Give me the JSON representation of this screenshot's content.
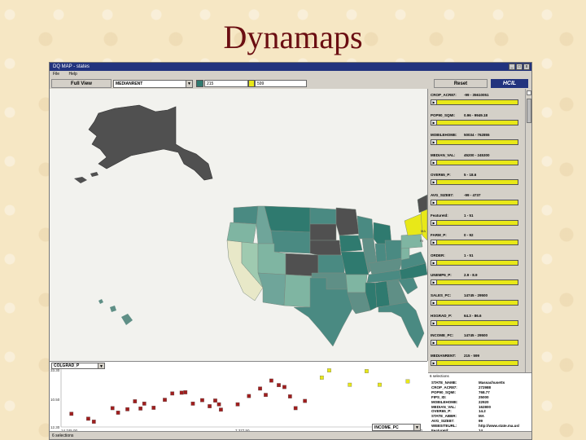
{
  "slide": {
    "title": "Dynamaps"
  },
  "window": {
    "title": "DQ MAP - states",
    "menu": [
      "File",
      "Help"
    ],
    "controls": [
      "_",
      "□",
      "x"
    ]
  },
  "toolbar": {
    "full_view_label": "Full View",
    "attribute_select": "MEDIANRENT",
    "range_low": "215",
    "range_high": "599",
    "reset_label": "Reset",
    "logo": "HCIL",
    "low_color": "#2f7a6f",
    "high_color": "#e8e818"
  },
  "sliders": [
    {
      "name": "CROP_ACR87:",
      "range": "-99 - 35610051"
    },
    {
      "name": "POP90_SQMI:",
      "range": "0.96 - 9949.18"
    },
    {
      "name": "MOBILEHOME:",
      "range": "50034 - 762855"
    },
    {
      "name": "MEDIAN_VAL:",
      "range": "45200 - 245300"
    },
    {
      "name": "OVER65_P:",
      "range": "5 - 18.6"
    },
    {
      "name": "AVG_SIZE87:",
      "range": "-99 - 4737"
    },
    {
      "name": "FeatureId:",
      "range": "1 - 51"
    },
    {
      "name": "FARM_P:",
      "range": "0 - 92"
    },
    {
      "name": "ORDER:",
      "range": "1 - 51"
    },
    {
      "name": "UNEMP6_P:",
      "range": "2.9 - 8.9"
    },
    {
      "name": "SALES_PC:",
      "range": "14745 - 29500"
    },
    {
      "name": "HSGRAD_P:",
      "range": "64.3 - 86.6"
    },
    {
      "name": "INCOME_PC:",
      "range": "14745 - 29500"
    },
    {
      "name": "MEDIANRENT:",
      "range": "215 - 599"
    }
  ],
  "scatter": {
    "y_attribute": "COLGRAD_P",
    "x_attribute": "INCOME_PC",
    "y_ticks": [
      "33.30",
      "10.50",
      "12.30"
    ],
    "x_ticks": [
      "14,745.00",
      "7,377.50",
      "29,500.00"
    ]
  },
  "chart_data": {
    "type": "scatter",
    "xlabel": "INCOME_PC",
    "ylabel": "COLGRAD_P",
    "series": [
      {
        "color": "#a01e1e",
        "points": [
          [
            15300,
            13.5
          ],
          [
            16200,
            12.2
          ],
          [
            16500,
            11.4
          ],
          [
            17500,
            15.0
          ],
          [
            17800,
            13.8
          ],
          [
            18300,
            14.7
          ],
          [
            18700,
            16.8
          ],
          [
            19000,
            14.9
          ],
          [
            19200,
            16.2
          ],
          [
            19700,
            15.1
          ],
          [
            20300,
            17.2
          ],
          [
            20700,
            18.9
          ],
          [
            21200,
            19.1
          ],
          [
            21400,
            19.2
          ],
          [
            21800,
            16.2
          ],
          [
            22300,
            17.1
          ],
          [
            22700,
            15.5
          ],
          [
            23000,
            17.0
          ],
          [
            23200,
            16.0
          ],
          [
            23300,
            14.6
          ],
          [
            24200,
            16.0
          ],
          [
            24800,
            18.2
          ],
          [
            25400,
            20.2
          ],
          [
            25700,
            18.5
          ],
          [
            26000,
            22.3
          ],
          [
            26400,
            21.1
          ],
          [
            26700,
            20.6
          ],
          [
            27000,
            18.1
          ],
          [
            27300,
            15.0
          ],
          [
            27800,
            16.9
          ]
        ]
      },
      {
        "color": "#e8e818",
        "points": [
          [
            28700,
            23.1
          ],
          [
            29100,
            25.0
          ],
          [
            30200,
            21.2
          ],
          [
            31100,
            24.8
          ],
          [
            31800,
            21.2
          ],
          [
            33300,
            22.1
          ]
        ]
      }
    ]
  },
  "details": {
    "header": "6 selections",
    "rows": [
      {
        "k": "STATE_NAME:",
        "v": "Massachusetts"
      },
      {
        "k": "CROP_ACR87:",
        "v": "272988"
      },
      {
        "k": "POP90_SQMI:",
        "v": "768.77"
      },
      {
        "k": "FIPS_ID:",
        "v": "25000"
      },
      {
        "k": "MOBILEHOME:",
        "v": "22920"
      },
      {
        "k": "MEDIAN_VAL:",
        "v": "162800"
      },
      {
        "k": "OVER65_P:",
        "v": "14.2"
      },
      {
        "k": "STATE_ABBR:",
        "v": "MA"
      },
      {
        "k": "AVG_SIZE87:",
        "v": "99"
      },
      {
        "k": "WEBSITEURL:",
        "v": "http://www.state.ma.us/"
      },
      {
        "k": "FeatureId:",
        "v": "14"
      }
    ]
  },
  "status": {
    "text": "6 selections"
  }
}
